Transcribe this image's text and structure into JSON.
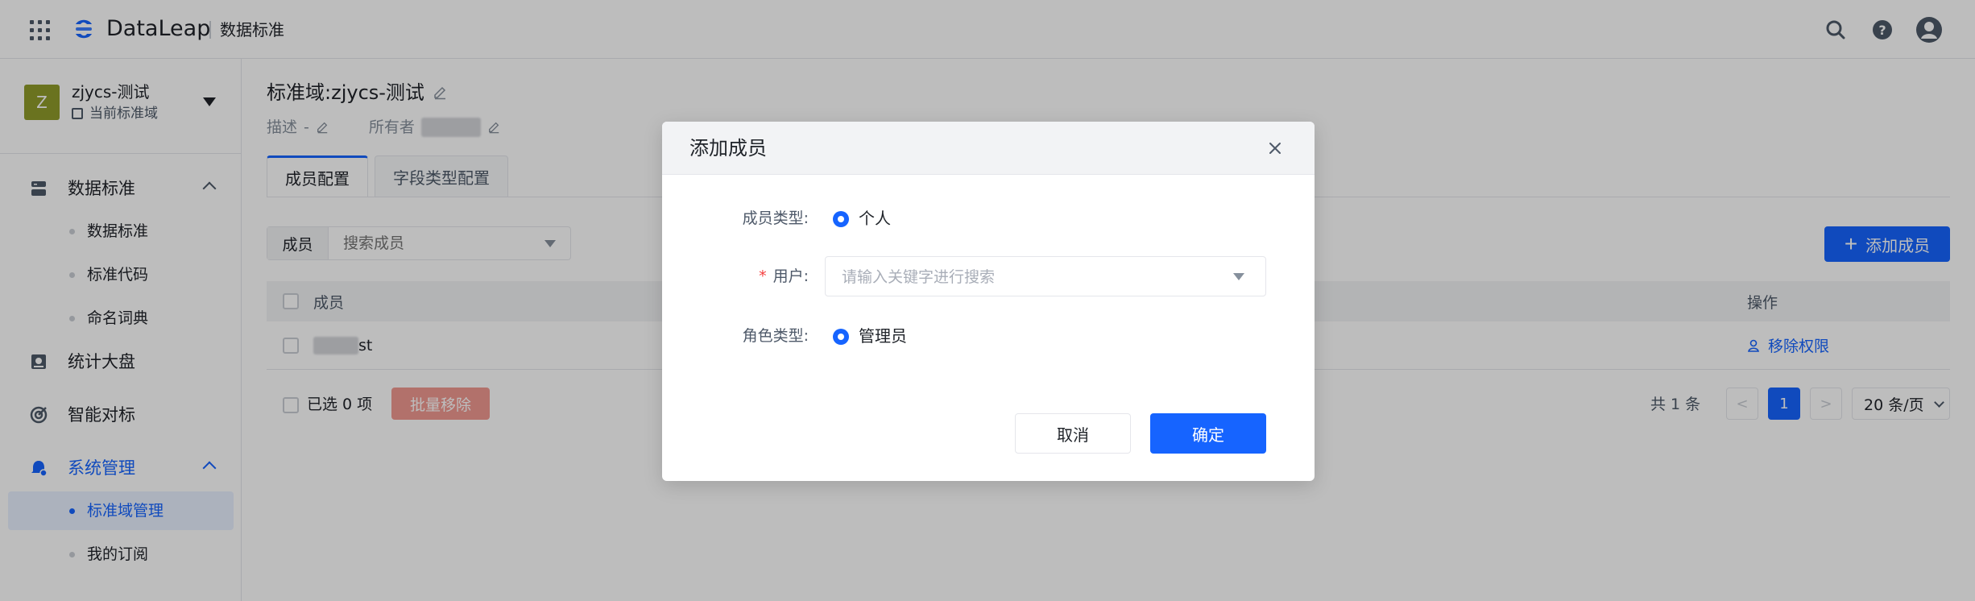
{
  "topbar": {
    "logo_text": "DataLeap",
    "product_name": "数据标准",
    "icons": [
      "apps-grid-icon",
      "dataleap-logo-icon",
      "search-icon",
      "help-icon",
      "user-avatar-icon"
    ]
  },
  "sidebar": {
    "domain": {
      "avatar_letter": "Z",
      "name": "zjycs-测试",
      "subtitle": "当前标准域"
    },
    "groups": [
      {
        "label": "数据标准",
        "icon": "database-icon",
        "expanded": true,
        "items": [
          {
            "label": "数据标准"
          },
          {
            "label": "标准代码"
          },
          {
            "label": "命名词典"
          }
        ]
      },
      {
        "label": "统计大盘",
        "icon": "dashboard-icon"
      },
      {
        "label": "智能对标",
        "icon": "target-icon"
      },
      {
        "label": "系统管理",
        "icon": "settings-bell-icon",
        "expanded": true,
        "active": true,
        "items": [
          {
            "label": "标准域管理",
            "active": true
          },
          {
            "label": "我的订阅"
          }
        ]
      }
    ]
  },
  "main": {
    "title_prefix": "标准域:",
    "title_name": "zjycs-测试",
    "meta": {
      "desc_label": "描述",
      "desc_value": "-",
      "owner_label": "所有者"
    },
    "tabs": [
      {
        "label": "成员配置",
        "active": true
      },
      {
        "label": "字段类型配置"
      }
    ],
    "filter": {
      "label": "成员",
      "placeholder": "搜索成员"
    },
    "add_member_label": "添加成员",
    "table": {
      "columns": [
        "成员",
        "操作"
      ],
      "rows": [
        {
          "member_suffix": "st",
          "action": "移除权限"
        }
      ]
    },
    "footer": {
      "selected_text": "已选 0 项",
      "batch_remove": "批量移除",
      "total_text": "共 1 条",
      "prev": "<",
      "current_page": "1",
      "next": ">",
      "page_size": "20 条/页"
    }
  },
  "modal": {
    "title": "添加成员",
    "member_type_label": "成员类型:",
    "member_type_value": "个人",
    "user_label": "用户:",
    "user_placeholder": "请输入关键字进行搜索",
    "role_type_label": "角色类型:",
    "role_type_value": "管理员",
    "cancel_label": "取消",
    "ok_label": "确定"
  },
  "colors": {
    "primary": "#1664ff",
    "danger_disabled": "#f08f86",
    "domain_avatar": "#8f9b2b",
    "required": "#f53f3f"
  }
}
